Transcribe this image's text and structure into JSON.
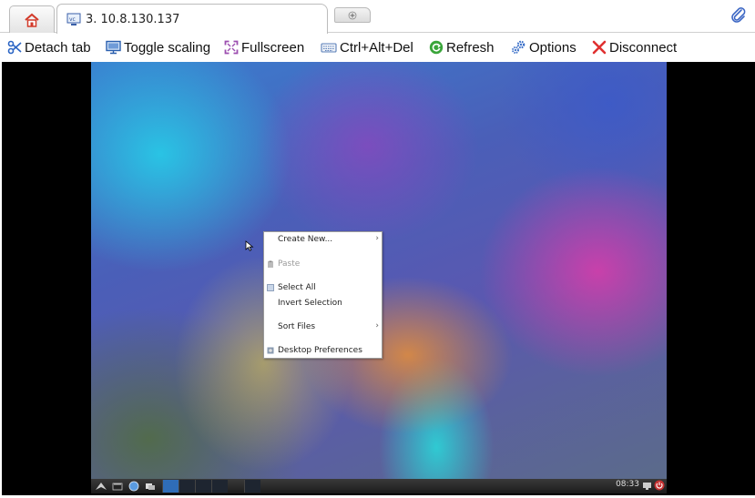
{
  "tabs": {
    "home_icon": "home-icon",
    "active_label": "3. 10.8.130.137",
    "active_icon": "vnc-icon",
    "new_tab_icon": "plus-icon",
    "attach_icon": "paperclip-icon"
  },
  "toolbar": {
    "detach": "Detach tab",
    "toggle_scaling": "Toggle scaling",
    "fullscreen": "Fullscreen",
    "ctrl_alt_del": "Ctrl+Alt+Del",
    "refresh": "Refresh",
    "options": "Options",
    "disconnect": "Disconnect"
  },
  "context_menu": {
    "create_new": "Create New...",
    "paste": "Paste",
    "select_all": "Select All",
    "invert_selection": "Invert Selection",
    "sort_files": "Sort Files",
    "desktop_preferences": "Desktop Preferences"
  },
  "taskbar": {
    "clock": "08:33"
  },
  "colors": {
    "detach": "#2a64c4",
    "fullscreen": "#9c4fb0",
    "refresh": "#3aa53a",
    "disconnect": "#e03030",
    "options": "#3a6fc8"
  }
}
